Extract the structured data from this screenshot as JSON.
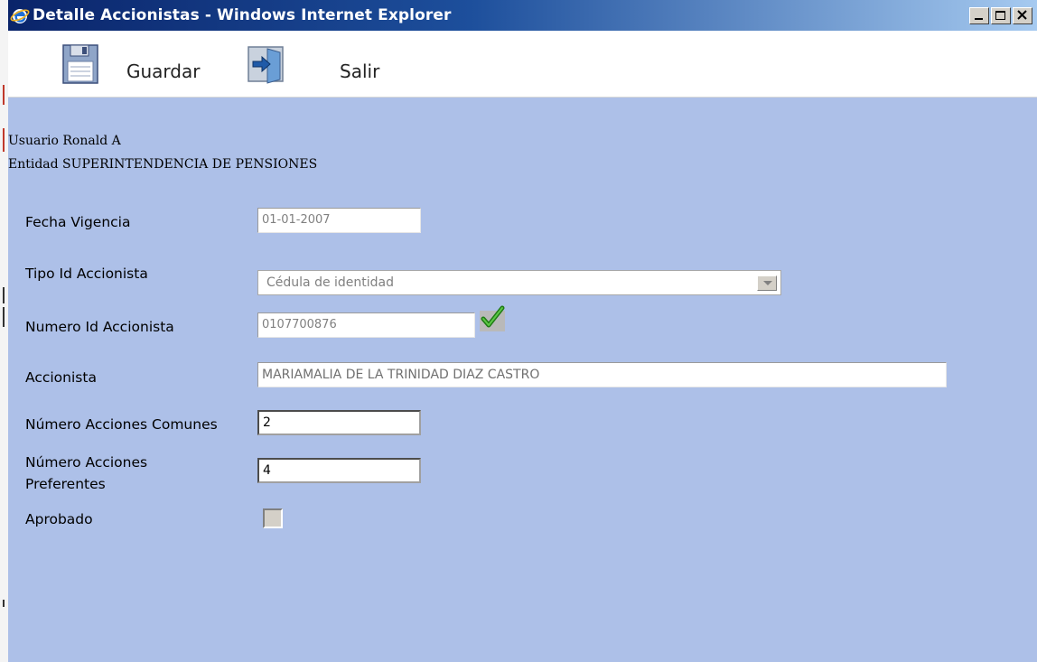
{
  "window": {
    "title": "Detalle Accionistas - Windows Internet Explorer",
    "icon": "ie-icon",
    "controls": [
      "minimize-icon",
      "maximize-icon",
      "close-icon"
    ]
  },
  "toolbar": {
    "save_label": "Guardar",
    "save_icon": "floppy-disk-icon",
    "exit_label": "Salir",
    "exit_icon": "exit-door-icon"
  },
  "info": {
    "usuario": "Usuario Ronald A",
    "entidad": "Entidad SUPERINTENDENCIA DE PENSIONES"
  },
  "form": {
    "fecha_vigencia": {
      "label": "Fecha Vigencia",
      "value": "01-01-2007"
    },
    "tipo_id": {
      "label": "Tipo Id Accionista",
      "value": "Cédula de identidad"
    },
    "numero_id": {
      "label": "Numero Id Accionista",
      "value": "0107700876",
      "validated_icon": "checkmark-icon"
    },
    "accionista": {
      "label": "Accionista",
      "value": "MARIAMALIA DE LA TRINIDAD DIAZ CASTRO"
    },
    "acciones_comunes": {
      "label": "Número Acciones Comunes",
      "value": "2"
    },
    "acciones_preferentes": {
      "label_line1": "Número Acciones",
      "label_line2": "Preferentes",
      "value": "4"
    },
    "aprobado": {
      "label": "Aprobado",
      "checked": false
    }
  },
  "colors": {
    "content_bg": "#adc0e8",
    "titlebar_start": "#0a246a",
    "titlebar_end": "#a6caf0",
    "check_green": "#2e8b1f"
  }
}
